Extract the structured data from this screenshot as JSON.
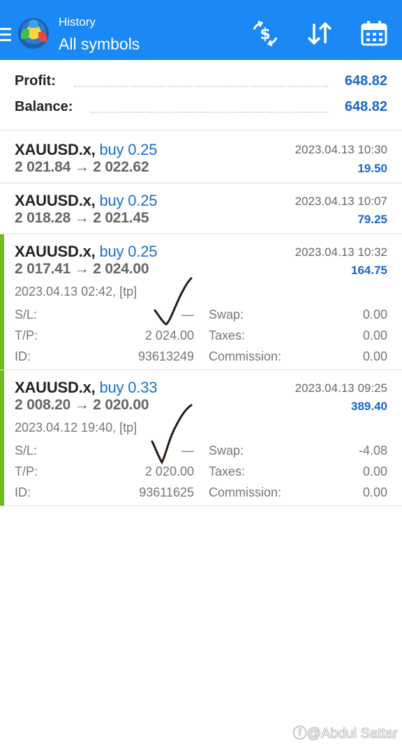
{
  "header": {
    "subtitle": "History",
    "title": "All symbols",
    "icons": [
      "menu-icon",
      "app-logo",
      "dollar-exchange-icon",
      "sort-icon",
      "calendar-icon"
    ],
    "accent_color": "#1a88f5"
  },
  "summary": {
    "profit_label": "Profit:",
    "profit_value": "648.82",
    "balance_label": "Balance:",
    "balance_value": "648.82"
  },
  "deals": [
    {
      "symbol": "XAUUSD.x,",
      "type": "buy 0.25",
      "prices": "2 021.84 → 2 022.62",
      "time": "2023.04.13 10:30",
      "profit": "19.50"
    },
    {
      "symbol": "XAUUSD.x,",
      "type": "buy 0.25",
      "prices": "2 018.28 → 2 021.45",
      "time": "2023.04.13 10:07",
      "profit": "79.25"
    },
    {
      "symbol": "XAUUSD.x,",
      "type": "buy 0.25",
      "prices": "2 017.41 → 2 024.00",
      "time": "2023.04.13 10:32",
      "profit": "164.75",
      "open": "2023.04.13 02:42, [tp]",
      "sl_label": "S/L:",
      "sl": "—",
      "tp_label": "T/P:",
      "tp": "2 024.00",
      "id_label": "ID:",
      "id": "93613249",
      "swap_label": "Swap:",
      "swap": "0.00",
      "taxes_label": "Taxes:",
      "taxes": "0.00",
      "commission_label": "Commission:",
      "commission": "0.00"
    },
    {
      "symbol": "XAUUSD.x,",
      "type": "buy 0.33",
      "prices": "2 008.20 → 2 020.00",
      "time": "2023.04.13 09:25",
      "profit": "389.40",
      "open": "2023.04.12 19:40, [tp]",
      "sl_label": "S/L:",
      "sl": "—",
      "tp_label": "T/P:",
      "tp": "2 020.00",
      "id_label": "ID:",
      "id": "93611625",
      "swap_label": "Swap:",
      "swap": "-4.08",
      "taxes_label": "Taxes:",
      "taxes": "0.00",
      "commission_label": "Commission:",
      "commission": "0.00"
    }
  ],
  "watermark": "ⓕ@Abdul Sattar"
}
